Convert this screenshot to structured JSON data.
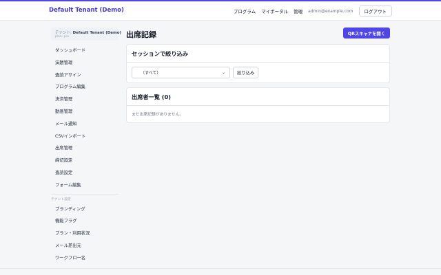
{
  "header": {
    "brand": "Default Tenant (Demo)",
    "nav": [
      "プログラム",
      "マイポータル",
      "管理"
    ],
    "email": "admin@example.com",
    "logout_label": "ログアウト"
  },
  "sidebar": {
    "tenant_prefix": "テナント:",
    "tenant_name": "Default Tenant (Demo)",
    "tenant_plan": "plan: pro",
    "items": [
      {
        "label": "ダッシュボード"
      },
      {
        "label": "演題管理"
      },
      {
        "label": "査読アサイン"
      },
      {
        "label": "プログラム編集"
      },
      {
        "label": "決済管理"
      },
      {
        "label": "動画管理"
      },
      {
        "label": "メール通知"
      },
      {
        "label": "CSVインポート"
      },
      {
        "label": "出席管理"
      },
      {
        "label": "締切設定"
      },
      {
        "label": "査読設定"
      },
      {
        "label": "フォーム編集"
      }
    ],
    "settings_heading": "テナント設定",
    "settings_items": [
      {
        "label": "ブランディング"
      },
      {
        "label": "機能フラグ"
      },
      {
        "label": "プラン・利用状況"
      },
      {
        "label": "メール差出元"
      },
      {
        "label": "ワークフロー名"
      }
    ]
  },
  "main": {
    "title": "出席記録",
    "qr_button": "QRスキャナを開く",
    "filter_card_title": "セッションで絞り込み",
    "select_value": "（すべて）",
    "filter_button": "絞り込み",
    "attendees_title": "出席者一覧 (0)",
    "empty_message": "まだ出席記録がありません。"
  },
  "colors": {
    "accent": "#4f46e5",
    "brand_text": "#4338ca"
  }
}
